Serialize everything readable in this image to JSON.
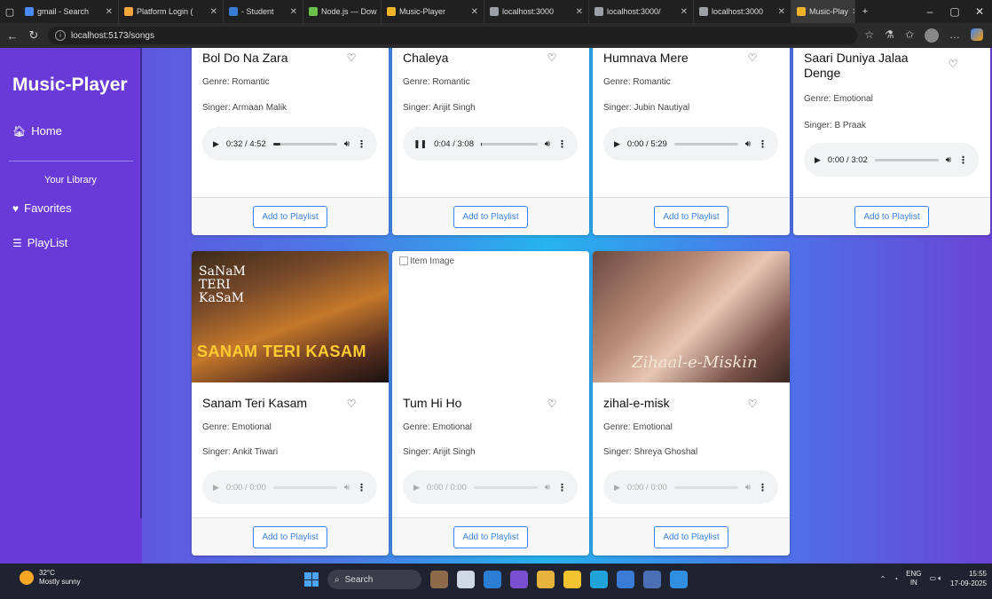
{
  "browser": {
    "tabs": [
      {
        "label": "gmail - Search",
        "color": "#4a8af4"
      },
      {
        "label": "Platform Login (",
        "color": "#f2a63b"
      },
      {
        "label": "- Student",
        "color": "#3a7bd5"
      },
      {
        "label": "Node.js — Dow",
        "color": "#6cc24a"
      },
      {
        "label": "Music-Player",
        "color": "#f0b429"
      },
      {
        "label": "localhost:3000",
        "color": "#9aa0a6"
      },
      {
        "label": "localhost:3000/",
        "color": "#9aa0a6"
      },
      {
        "label": "localhost:3000",
        "color": "#9aa0a6"
      },
      {
        "label": "Music-Play",
        "color": "#f0b429"
      }
    ],
    "url": "localhost:5173/songs"
  },
  "sidebar": {
    "brand": "Music-Player",
    "home": "Home",
    "library_title": "Your Library",
    "favorites": "Favorites",
    "playlist": "PlayList"
  },
  "songs": [
    {
      "title": "Bol Do Na Zara",
      "genre": "Genre: Romantic",
      "singer": "Singer: Armaan Malik",
      "time": "0:32 / 4:52",
      "progress": 0.11,
      "playing": false,
      "enabled": true
    },
    {
      "title": "Chaleya",
      "genre": "Genre: Romantic",
      "singer": "Singer: Arijit Singh",
      "time": "0:04 / 3:08",
      "progress": 0.02,
      "playing": true,
      "enabled": true
    },
    {
      "title": "Humnava Mere",
      "genre": "Genre: Romantic",
      "singer": "Singer: Jubin Nautiyal",
      "time": "0:00 / 5:29",
      "progress": 0,
      "playing": false,
      "enabled": true
    },
    {
      "title": "Saari Duniya Jalaa Denge",
      "genre": "Genre: Emotional",
      "singer": "Singer: B Praak",
      "time": "0:00 / 3:02",
      "progress": 0,
      "playing": false,
      "enabled": true
    },
    {
      "title": "Sanam Teri Kasam",
      "genre": "Genre: Emotional",
      "singer": "Singer: Ankit Tiwari",
      "time": "0:00 / 0:00",
      "progress": 0,
      "playing": false,
      "enabled": false,
      "image_text_top": "SaNaM TERI KaSaM",
      "image_text_bottom": "SANAM TERI KASAM"
    },
    {
      "title": "Tum Hi Ho",
      "genre": "Genre: Emotional",
      "singer": "Singer: Arijit Singh",
      "time": "0:00 / 0:00",
      "progress": 0,
      "playing": false,
      "enabled": false,
      "image_alt": "Item Image"
    },
    {
      "title": "zihal-e-misk",
      "genre": "Genre: Emotional",
      "singer": "Singer: Shreya Ghoshal",
      "time": "0:00 / 0:00",
      "progress": 0,
      "playing": false,
      "enabled": false,
      "image_text_bottom": "Zihaal-e-Miskin"
    }
  ],
  "add_to_playlist_label": "Add to Playlist",
  "taskbar": {
    "temp": "32°C",
    "weather": "Mostly sunny",
    "search": "Search",
    "lang": "ENG",
    "region": "IN",
    "time": "15:55",
    "date": "17-09-2025"
  },
  "colors": {
    "sidebar": "#6a3ad8",
    "button_accent": "#3b82f6"
  }
}
